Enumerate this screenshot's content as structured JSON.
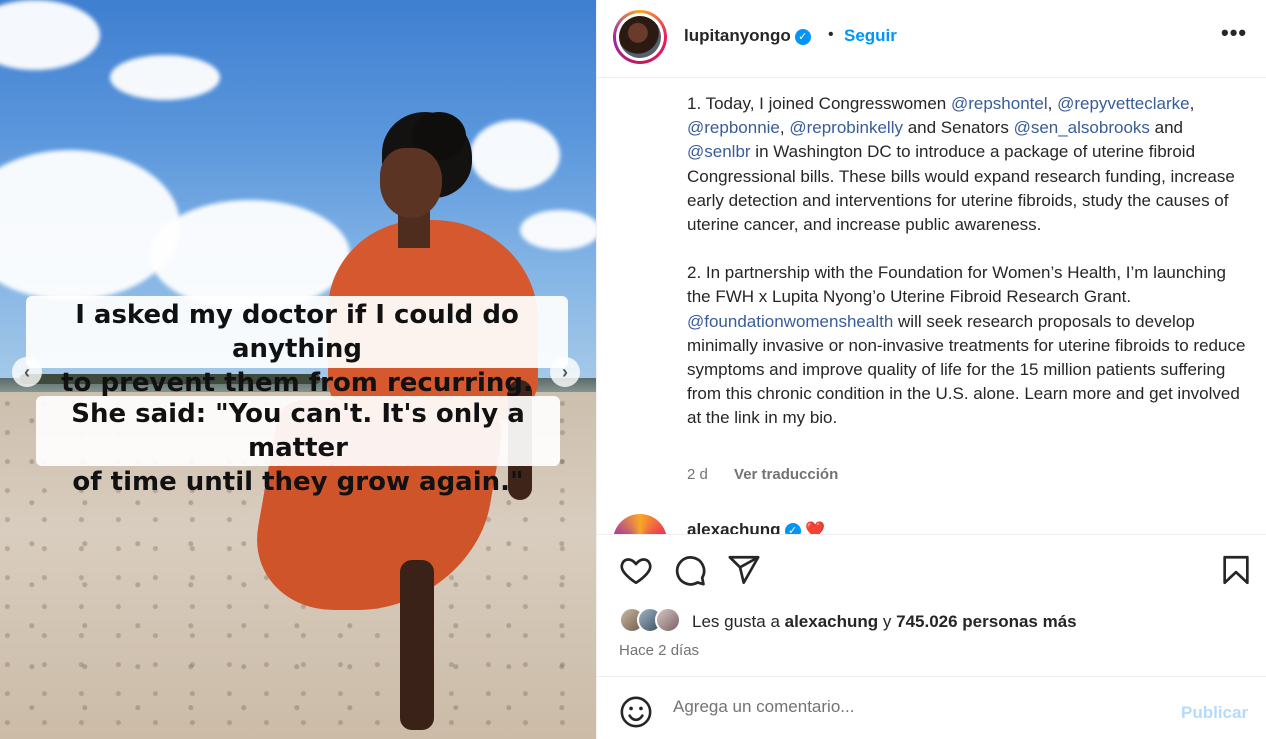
{
  "post": {
    "caption_overlay": {
      "line1": "I asked my doctor if I could do anything",
      "line2": "to prevent them from recurring.",
      "line3": "She said: \"You can't. It's only a matter",
      "line4": "of time until they grow again.\""
    },
    "nav_prev": "‹",
    "nav_next": "›"
  },
  "header": {
    "username": "lupitanyongo",
    "verified_mark": "✓",
    "separator": "•",
    "follow_label": "Seguir",
    "more_label": "•••"
  },
  "caption": {
    "p1": [
      {
        "t": "1. Today, I joined Congresswomen "
      },
      {
        "t": "@repshontel",
        "m": true
      },
      {
        "t": ", "
      },
      {
        "t": "@repyvetteclarke",
        "m": true
      },
      {
        "t": ", "
      },
      {
        "t": "@repbonnie",
        "m": true
      },
      {
        "t": ", "
      },
      {
        "t": "@reprobinkelly",
        "m": true
      },
      {
        "t": " and Senators "
      },
      {
        "t": "@sen_alsobrooks",
        "m": true
      },
      {
        "t": " and "
      },
      {
        "t": "@senlbr",
        "m": true
      },
      {
        "t": " in Washington DC to introduce a package of uterine fibroid Congressional bills. These bills would expand research funding, increase early detection and interventions for uterine fibroids, study the causes of uterine cancer, and increase public awareness."
      }
    ],
    "p2": [
      {
        "t": "2. In partnership with the Foundation for Women’s Health, I’m launching the FWH x Lupita Nyong’o Uterine Fibroid Research Grant. "
      },
      {
        "t": "@foundationwomenshealth",
        "m": true
      },
      {
        "t": " will seek research proposals to develop minimally invasive or non-invasive treatments for uterine fibroids to reduce symptoms and improve quality of life for the 15 million patients suffering from this chronic condition in the U.S. alone. Learn more and get involved at the link in my bio."
      }
    ],
    "age": "2 d",
    "translate_label": "Ver traducción"
  },
  "comment": {
    "username": "alexachung",
    "verified_mark": "✓",
    "emoji": "❤️"
  },
  "actions": {
    "likes_prefix": "Les gusta a ",
    "likes_user": "alexachung",
    "likes_middle": " y ",
    "likes_count": "745.026 personas más",
    "time": "Hace 2 días"
  },
  "add_comment": {
    "placeholder": "Agrega un comentario...",
    "publish_label": "Publicar"
  },
  "colors": {
    "accent": "#0095f6",
    "mention": "#385c9a",
    "muted": "#737373",
    "publish_disabled": "#b3dbff"
  }
}
